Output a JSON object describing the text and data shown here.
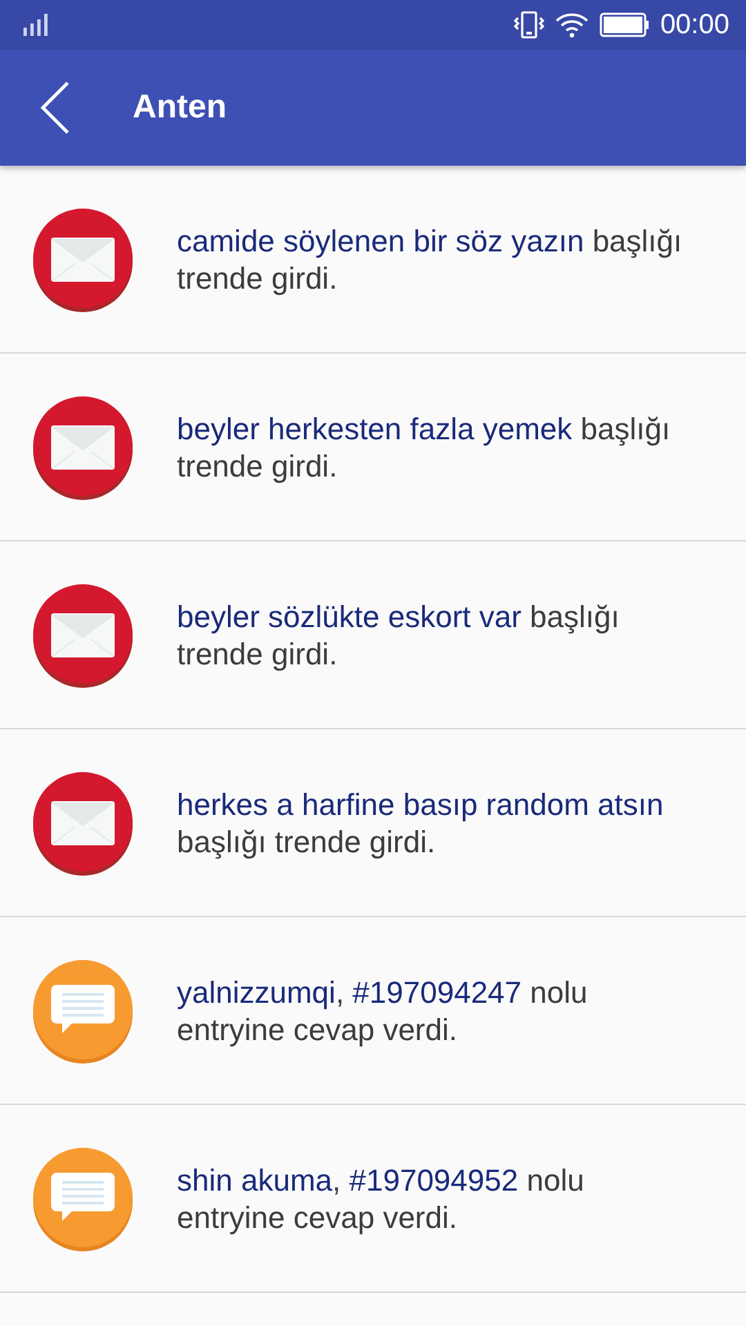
{
  "status_bar": {
    "time": "00:00"
  },
  "app_bar": {
    "title": "Anten"
  },
  "notifications": [
    {
      "kind": "trend",
      "parts": [
        {
          "text": "camide söylenen bir söz yazın",
          "link": true
        },
        {
          "text": " başlığı trende girdi.",
          "link": false
        }
      ]
    },
    {
      "kind": "trend",
      "parts": [
        {
          "text": "beyler herkesten fazla yemek",
          "link": true
        },
        {
          "text": " başlığı trende girdi.",
          "link": false
        }
      ]
    },
    {
      "kind": "trend",
      "parts": [
        {
          "text": "beyler sözlükte eskort var",
          "link": true
        },
        {
          "text": " başlığı trende girdi.",
          "link": false
        }
      ]
    },
    {
      "kind": "trend",
      "parts": [
        {
          "text": "herkes a harfine basıp random atsın",
          "link": true
        },
        {
          "text": " başlığı trende girdi.",
          "link": false
        }
      ]
    },
    {
      "kind": "reply",
      "parts": [
        {
          "text": "yalnizzumqi",
          "link": true
        },
        {
          "text": ", ",
          "link": false
        },
        {
          "text": "#197094247",
          "link": true
        },
        {
          "text": " nolu entryine cevap verdi.",
          "link": false
        }
      ]
    },
    {
      "kind": "reply",
      "parts": [
        {
          "text": "shin akuma",
          "link": true
        },
        {
          "text": ", ",
          "link": false
        },
        {
          "text": "#197094952",
          "link": true
        },
        {
          "text": " nolu entryine cevap verdi.",
          "link": false
        }
      ]
    }
  ]
}
